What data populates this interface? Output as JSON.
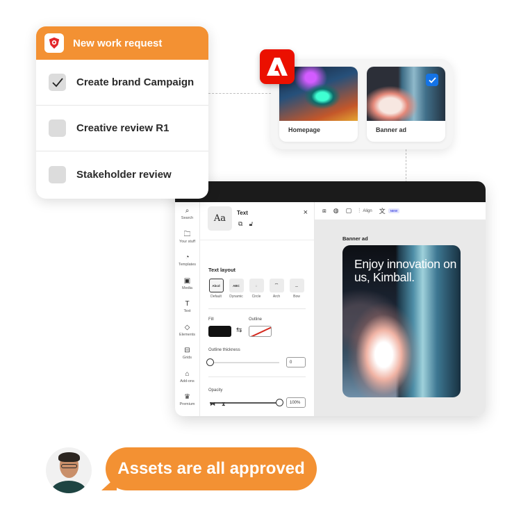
{
  "work_request": {
    "title": "New work request",
    "logo_icon": "lion-shield-icon",
    "items": [
      {
        "label": "Create brand Campaign",
        "checked": true
      },
      {
        "label": "Creative review R1",
        "checked": false
      },
      {
        "label": "Stakeholder review",
        "checked": false
      }
    ]
  },
  "assets": {
    "items": [
      {
        "label": "Homepage",
        "approved": false
      },
      {
        "label": "Banner ad",
        "approved": true
      }
    ]
  },
  "editor": {
    "rail": [
      {
        "icon": "search-icon",
        "glyph": "⌕",
        "label": "Search"
      },
      {
        "icon": "folder-icon",
        "glyph": "🗀",
        "label": "Your stuff"
      },
      {
        "icon": "templates-icon",
        "glyph": "◔",
        "label": "Templates"
      },
      {
        "icon": "media-icon",
        "glyph": "▣",
        "label": "Media"
      },
      {
        "icon": "text-icon",
        "glyph": "T",
        "label": "Text"
      },
      {
        "icon": "elements-icon",
        "glyph": "◇",
        "label": "Elements"
      },
      {
        "icon": "grids-icon",
        "glyph": "⊟",
        "label": "Grids"
      },
      {
        "icon": "addons-icon",
        "glyph": "⌂",
        "label": "Add-ons"
      },
      {
        "icon": "crown-icon",
        "glyph": "♛",
        "label": "Premium"
      }
    ],
    "panel": {
      "preview": "Aa",
      "title": "Text",
      "close": "×",
      "text_layout_title": "Text layout",
      "layouts": [
        {
          "label": "Default",
          "preview": "Abcd",
          "selected": true
        },
        {
          "label": "Dynamic",
          "preview": "ABC",
          "selected": false
        },
        {
          "label": "Circle",
          "preview": "◌",
          "selected": false
        },
        {
          "label": "Arch",
          "preview": "⌒",
          "selected": false
        },
        {
          "label": "Bow",
          "preview": "‿",
          "selected": false
        }
      ],
      "fill_label": "Fill",
      "fill_color": "#111111",
      "outline_label": "Outline",
      "outline_thickness_label": "Outline thickness",
      "outline_thickness_value": "0",
      "outline_thickness_fraction": 0,
      "opacity_label": "Opacity",
      "opacity_value": "100%",
      "opacity_fraction": 1.0
    },
    "toolbar": {
      "align_label": "Align",
      "new_badge": "NEW"
    },
    "canvas": {
      "artboard_label": "Banner ad",
      "headline": "Enjoy innovation on us, Kimball."
    }
  },
  "chat": {
    "message": "Assets are all approved"
  },
  "colors": {
    "accent_orange": "#f39133",
    "adobe_red": "#eb1000",
    "check_blue": "#1473e6"
  }
}
